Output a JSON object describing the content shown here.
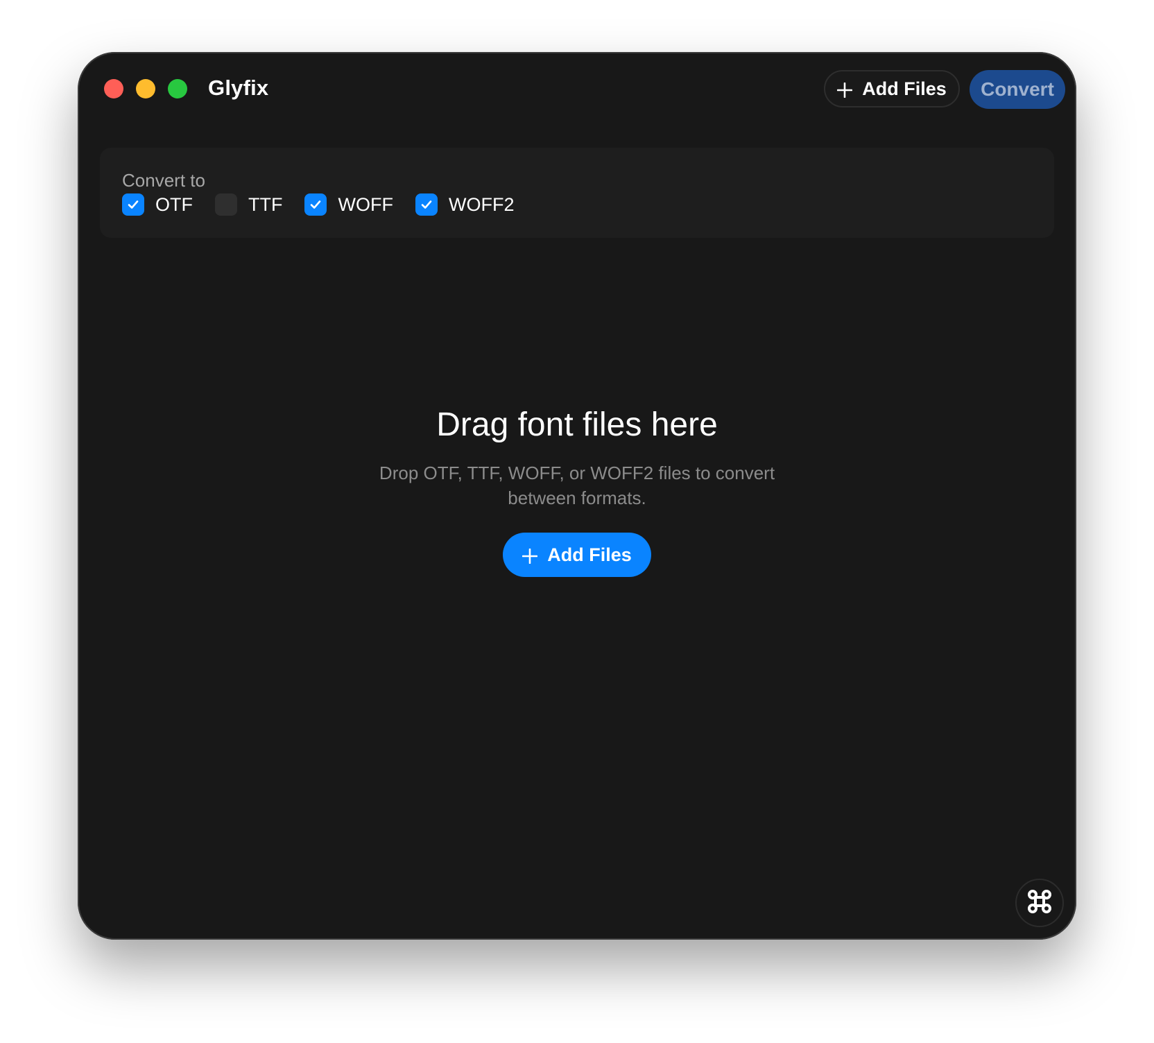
{
  "window": {
    "title": "Glyfix"
  },
  "toolbar": {
    "add_files_label": "Add Files",
    "convert_label": "Convert",
    "add_icon": "plus-icon"
  },
  "options": {
    "label": "Convert to",
    "formats": [
      {
        "label": "OTF",
        "checked": true
      },
      {
        "label": "TTF",
        "checked": false
      },
      {
        "label": "WOFF",
        "checked": true
      },
      {
        "label": "WOFF2",
        "checked": true
      }
    ]
  },
  "dropzone": {
    "title": "Drag font files here",
    "subtitle": "Drop OTF, TTF, WOFF, or WOFF2 files to convert between formats.",
    "button_label": "Add Files"
  },
  "footer": {
    "icon": "command-icon"
  },
  "colors": {
    "window_bg": "#181818",
    "accent": "#0a84ff",
    "convert_bg": "#1c4a8e",
    "close": "#ff5f57",
    "minimize": "#febc2e",
    "zoom": "#28c840"
  }
}
